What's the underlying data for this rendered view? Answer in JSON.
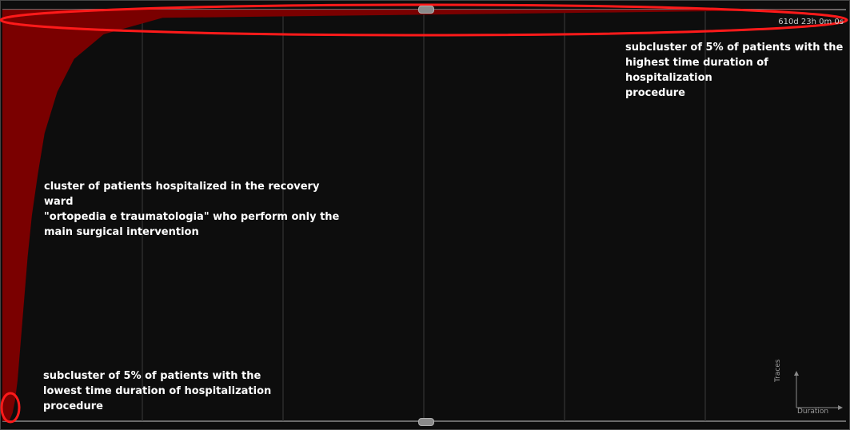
{
  "chart_data": {
    "type": "area",
    "xlabel": "Duration",
    "ylabel": "Traces",
    "max_duration_label": "610d 23h 0m 0s",
    "fill_color": "#7a0000",
    "highlight_color": "#ff1a1a",
    "grid": true,
    "y_fraction_of_traces": [
      0,
      0.02,
      0.05,
      0.1,
      0.2,
      0.3,
      0.4,
      0.5,
      0.6,
      0.7,
      0.8,
      0.88,
      0.94,
      0.98,
      1.0
    ],
    "x_fraction_of_max_duration": [
      0.008,
      0.012,
      0.015,
      0.018,
      0.022,
      0.026,
      0.03,
      0.035,
      0.042,
      0.05,
      0.065,
      0.085,
      0.12,
      0.19,
      1.0
    ],
    "annotations": {
      "highest": "subcluster of 5% of patients with the\nhighest time duration of hospitalization\nprocedure",
      "cluster": "cluster of patients hospitalized in the recovery ward\n\"ortopedia e traumatologia\" who perform only the\nmain surgical intervention",
      "lowest": "subcluster of 5% of patients with the\nlowest time duration of hospitalization\nprocedure"
    }
  }
}
